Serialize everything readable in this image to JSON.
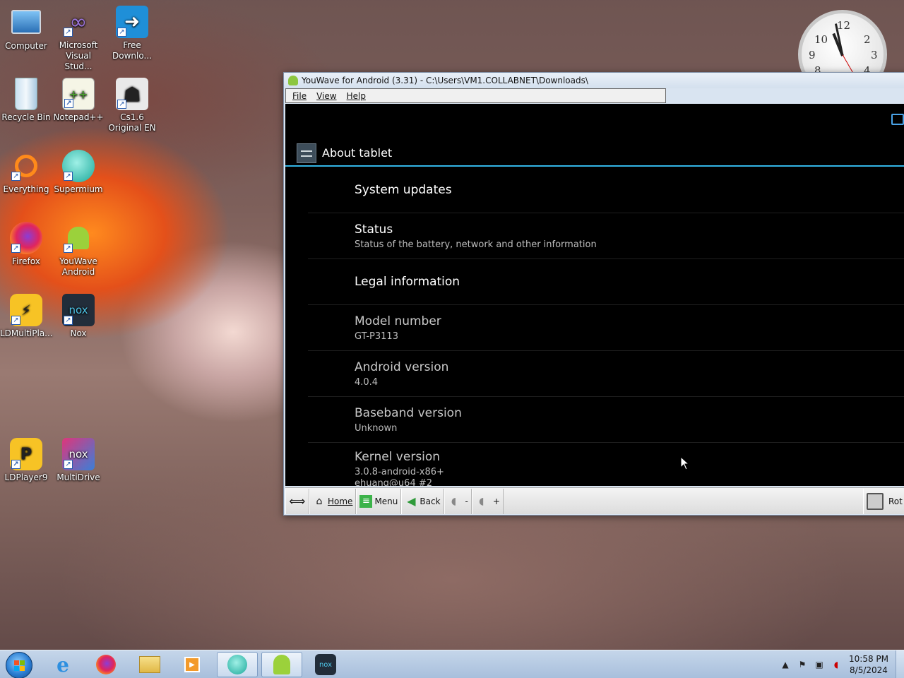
{
  "desktop": {
    "icons": [
      {
        "label": "Computer",
        "icon": "computer-icon"
      },
      {
        "label": "Microsoft Visual Stud...",
        "icon": "visual-studio-icon"
      },
      {
        "label": "Free Downlo...",
        "icon": "free-download-manager-icon"
      },
      {
        "label": "Recycle Bin",
        "icon": "recycle-bin-icon"
      },
      {
        "label": "Notepad++",
        "icon": "notepad-plus-plus-icon"
      },
      {
        "label": "Cs1.6 Original EN",
        "icon": "counter-strike-icon"
      },
      {
        "label": "Everything",
        "icon": "everything-search-icon"
      },
      {
        "label": "Supermium",
        "icon": "supermium-icon"
      },
      {
        "label": "Firefox",
        "icon": "firefox-icon"
      },
      {
        "label": "YouWave Android",
        "icon": "youwave-android-icon"
      },
      {
        "label": "LDMultiPla...",
        "icon": "ldmultiplayer-icon"
      },
      {
        "label": "Nox",
        "icon": "nox-icon"
      },
      {
        "label": "LDPlayer9",
        "icon": "ldplayer-icon"
      },
      {
        "label": "MultiDrive",
        "icon": "multidrive-icon"
      }
    ]
  },
  "clock_gadget": {
    "numbers": [
      "10",
      "12",
      "2",
      "3",
      "4",
      "8",
      "9"
    ],
    "time": "10:58"
  },
  "window": {
    "title": "YouWave for Android (3.31) - C:\\Users\\VM1.COLLABNET\\Downloads\\",
    "menu": [
      "File",
      "View",
      "Help"
    ],
    "android": {
      "screen_title": "About tablet",
      "items": [
        {
          "title": "System updates",
          "summary": ""
        },
        {
          "title": "Status",
          "summary": "Status of the battery, network and other information"
        },
        {
          "title": "Legal information",
          "summary": ""
        },
        {
          "title": "Model number",
          "summary": "GT-P3113"
        },
        {
          "title": "Android version",
          "summary": "4.0.4"
        },
        {
          "title": "Baseband version",
          "summary": "Unknown"
        },
        {
          "title": "Kernel version",
          "summary": "3.0.8-android-x86+",
          "summary2": "ehuang@u64 #2"
        }
      ]
    },
    "toolbar": {
      "resize_symbol": "⟺",
      "home": "Home",
      "menu": "Menu",
      "back": "Back",
      "vol_down": "-",
      "vol_up": "+",
      "rotate": "Rot"
    }
  },
  "taskbar": {
    "time": "10:58 PM",
    "date": "8/5/2024",
    "pinned": [
      "start-button",
      "internet-explorer-icon",
      "firefox-icon",
      "file-explorer-icon",
      "media-player-icon",
      "supermium-icon",
      "youwave-android-icon",
      "nox-icon"
    ]
  }
}
